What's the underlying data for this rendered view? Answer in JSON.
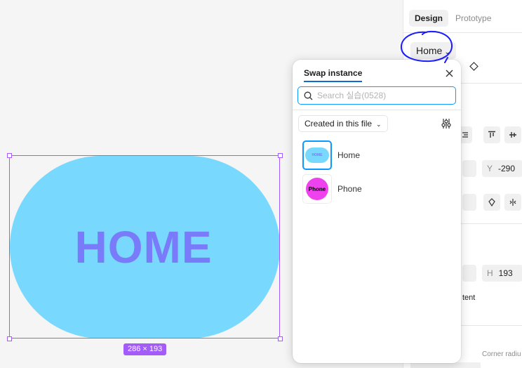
{
  "canvas": {
    "frame_text": "HOME",
    "size_badge": "286 × 193",
    "frame_color": "#79d8fd",
    "text_color": "#7a7bfb",
    "selection_color": "#a35cf9"
  },
  "panel": {
    "tabs": [
      {
        "label": "Design",
        "active": true
      },
      {
        "label": "Prototype",
        "active": false
      }
    ],
    "instance_button": {
      "label": "Home",
      "icon": "chevron-down-icon"
    },
    "position": {
      "y_label": "Y",
      "y_value": "-290"
    },
    "size": {
      "h_label": "H",
      "h_value": "193"
    },
    "clip_content_partial": "tent",
    "corner_radius_label_partial": "Corner radiu"
  },
  "swap_popover": {
    "title": "Swap instance",
    "search_placeholder": "Search 실습(0528)",
    "library_select": "Created in this file",
    "components": [
      {
        "name": "Home",
        "thumb_text": "HOME",
        "selected": true
      },
      {
        "name": "Phone",
        "thumb_text": "Phone",
        "selected": false
      }
    ]
  },
  "colors": {
    "accent": "#0d99ff",
    "annotation_ink": "#1a1aff",
    "phone_color": "#ee42ee"
  }
}
